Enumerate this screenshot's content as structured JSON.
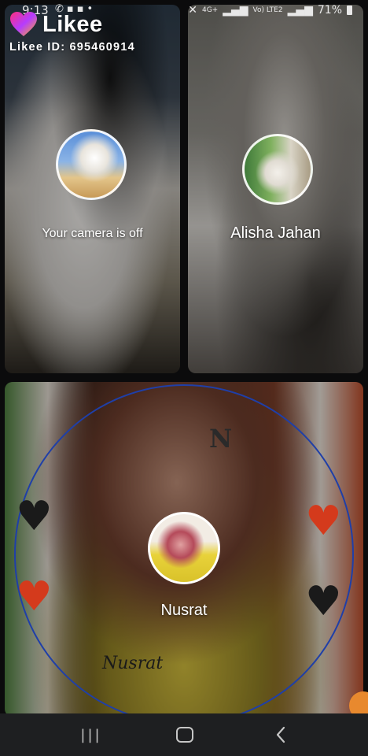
{
  "app": {
    "brand_name": "Likee",
    "likee_id": "Likee ID: 695460914"
  },
  "status_bar": {
    "time": "9:13",
    "network": "4G+",
    "volte": "Vo) LTE2",
    "battery": "71%"
  },
  "participants": [
    {
      "name": "Your camera is off"
    },
    {
      "name": "Alisha Jahan"
    },
    {
      "name": "Nusrat"
    }
  ],
  "decor": {
    "letter": "N",
    "signature": "Nusrat"
  },
  "icons": {
    "logo": "heart-logo-icon",
    "call": "phone-icon",
    "wifi_off": "wifi-off-icon",
    "battery": "battery-icon",
    "recents": "recents-icon",
    "home": "home-icon",
    "back": "back-icon"
  },
  "colors": {
    "ring": "#1f3fa8",
    "logo_gradient_start": "#ff2e7a",
    "logo_gradient_end": "#ffb020",
    "nav_bar": "#1e1f21",
    "badge": "#e8892e"
  }
}
